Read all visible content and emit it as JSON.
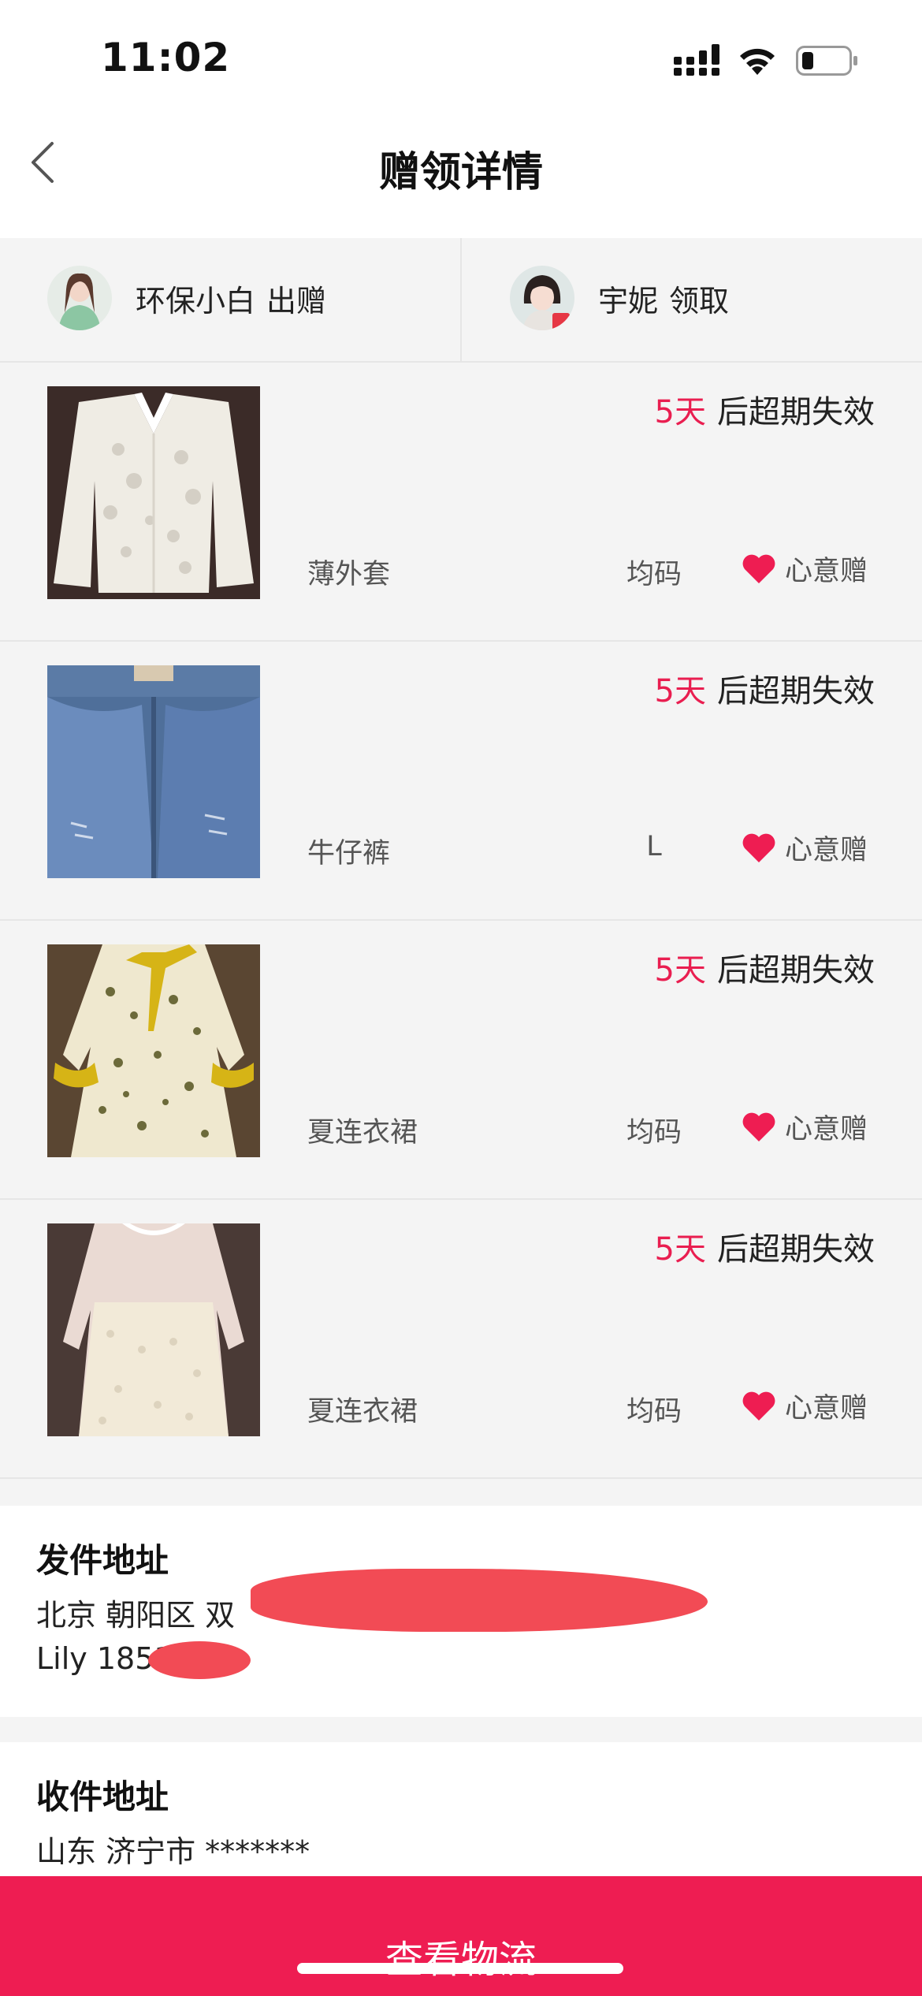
{
  "status_bar": {
    "time": "11:02"
  },
  "nav": {
    "title": "赠领详情",
    "back_icon": "chevron-left-icon"
  },
  "participants": {
    "giver": {
      "name": "环保小白",
      "role": "出赠"
    },
    "taker": {
      "name": "宇妮",
      "role": "领取"
    }
  },
  "items": [
    {
      "days": "5天",
      "expire_suffix": "后超期失效",
      "name": "薄外套",
      "size": "均码",
      "gift_type": "心意赠"
    },
    {
      "days": "5天",
      "expire_suffix": "后超期失效",
      "name": "牛仔裤",
      "size": "L",
      "gift_type": "心意赠"
    },
    {
      "days": "5天",
      "expire_suffix": "后超期失效",
      "name": "夏连衣裙",
      "size": "均码",
      "gift_type": "心意赠"
    },
    {
      "days": "5天",
      "expire_suffix": "后超期失效",
      "name": "夏连衣裙",
      "size": "均码",
      "gift_type": "心意赠"
    }
  ],
  "sender_address": {
    "title": "发件地址",
    "line1": "北京 朝阳区 双",
    "line2": "Lily 1851    344"
  },
  "receiver_address": {
    "title": "收件地址",
    "line1": "山东 济宁市 *******"
  },
  "cta": {
    "label": "查看物流"
  },
  "colors": {
    "accent": "#ee1d52",
    "days_text": "#e91e50",
    "background": "#f4f4f4",
    "redaction": "#f24b55"
  }
}
